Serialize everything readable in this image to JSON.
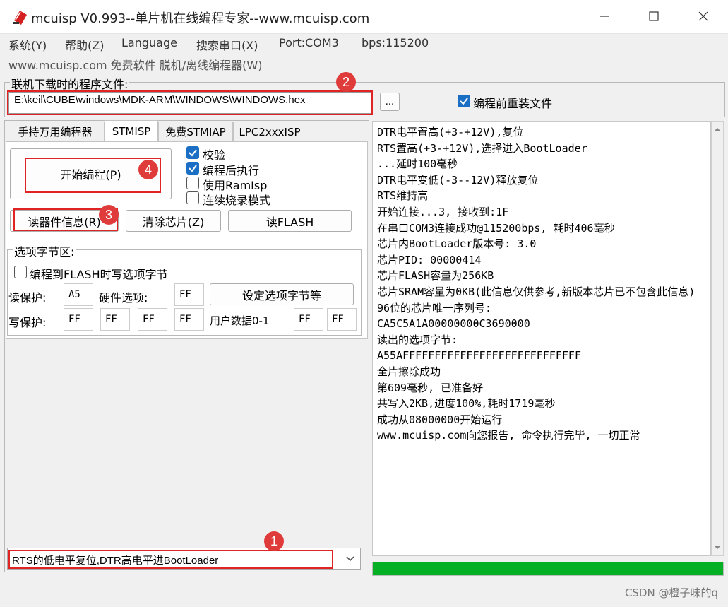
{
  "window": {
    "title": "mcuisp V0.993--单片机在线编程专家--www.mcuisp.com"
  },
  "menu": [
    "系统(Y)",
    "帮助(Z)",
    "Language",
    "搜索串口(X)",
    "Port:COM3",
    "bps:115200"
  ],
  "menu_line2": "www.mcuisp.com 免费软件 脱机/离线编程器(W)",
  "file": {
    "label": "联机下载时的程序文件:",
    "path": "E:\\keil\\CUBE\\windows\\MDK-ARM\\WINDOWS\\WINDOWS.hex",
    "browse_label": "...",
    "reload_label": "编程前重装文件",
    "reload_checked": true
  },
  "tabs": [
    {
      "label": "手持万用编程器",
      "active": false
    },
    {
      "label": "STMISP",
      "active": true
    },
    {
      "label": "免费STMIAP",
      "active": false
    },
    {
      "label": "LPC2xxxISP",
      "active": false
    }
  ],
  "actions": {
    "start": "开始编程(P)",
    "read_info": "读器件信息(R)",
    "erase": "清除芯片(Z)",
    "read_flash": "读FLASH"
  },
  "options": [
    {
      "label": "校验",
      "checked": true
    },
    {
      "label": "编程后执行",
      "checked": true
    },
    {
      "label": "使用RamIsp",
      "checked": false
    },
    {
      "label": "连续烧录模式",
      "checked": false
    }
  ],
  "option_bytes": {
    "group_label": "选项字节区:",
    "write_on_flash": "编程到FLASH时写选项字节",
    "write_on_flash_checked": false,
    "read_protect_label": "读保护:",
    "read_protect_value": "A5",
    "hw_option_label": "硬件选项:",
    "hw_option_value": "FF",
    "set_button": "设定选项字节等",
    "write_protect_label": "写保护:",
    "write_protect_values": [
      "FF",
      "FF",
      "FF",
      "FF"
    ],
    "user_data_label": "用户数据0-1",
    "user_data_values": [
      "FF",
      "FF"
    ]
  },
  "boot_mode": "RTS的低电平复位,DTR高电平进BootLoader",
  "log": [
    "DTR电平置高(+3-+12V),复位",
    "RTS置高(+3-+12V),选择进入BootLoader",
    "...延时100毫秒",
    "DTR电平变低(-3--12V)释放复位",
    "RTS维持高",
    "开始连接...3, 接收到:1F",
    "在串口COM3连接成功@115200bps, 耗时406毫秒",
    "芯片内BootLoader版本号: 3.0",
    "芯片PID: 00000414",
    "芯片FLASH容量为256KB",
    "芯片SRAM容量为0KB(此信息仅供参考,新版本芯片已不包含此信息)",
    "96位的芯片唯一序列号:",
    "CA5C5A1A00000000C3690000",
    "读出的选项字节:",
    "A55AFFFFFFFFFFFFFFFFFFFFFFFFFFFF",
    "全片擦除成功",
    "第609毫秒, 已准备好",
    "共写入2KB,进度100%,耗时1719毫秒",
    "成功从08000000开始运行",
    "www.mcuisp.com向您报告, 命令执行完毕, 一切正常"
  ],
  "progress": 1.0,
  "annotations": [
    "2",
    "4",
    "3",
    "1"
  ],
  "watermark": "CSDN @橙子味的q",
  "colors": {
    "accent": "#1a6fc4",
    "progress": "#06b025",
    "annotation": "#e02424"
  }
}
